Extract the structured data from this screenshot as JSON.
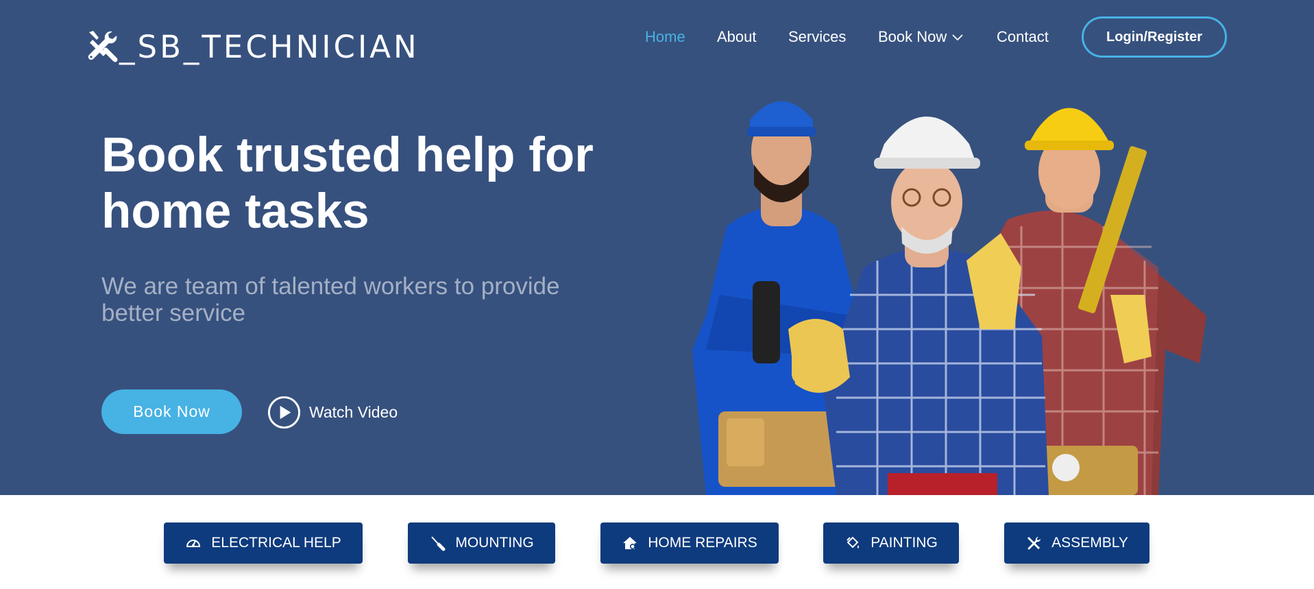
{
  "brand": {
    "name": "_SB_TECHNICIAN",
    "icon": "wrench-screwdriver-icon"
  },
  "nav": {
    "items": [
      {
        "label": "Home",
        "active": true
      },
      {
        "label": "About",
        "active": false
      },
      {
        "label": "Services",
        "active": false
      },
      {
        "label": "Book Now",
        "active": false,
        "dropdown": true
      },
      {
        "label": "Contact",
        "active": false
      }
    ],
    "login_label": "Login/Register"
  },
  "hero": {
    "title": "Book trusted help for home tasks",
    "subtitle": "We are team of talented workers to provide better service",
    "cta_label": "Book Now",
    "video_label": "Watch Video",
    "video_icon": "play-circle-icon",
    "image": "three construction workers with helmets and tools"
  },
  "services": [
    {
      "label": "ELECTRICAL HELP",
      "icon": "gauge-icon"
    },
    {
      "label": "MOUNTING",
      "icon": "screwdriver-icon"
    },
    {
      "label": "HOME REPAIRS",
      "icon": "house-gear-icon"
    },
    {
      "label": "PAINTING",
      "icon": "paint-bucket-icon"
    },
    {
      "label": "ASSEMBLY",
      "icon": "tools-icon"
    }
  ],
  "colors": {
    "hero_bg": "#37517e",
    "accent": "#47b2e4",
    "service_button": "#0e3b7e",
    "subtitle_text": "#a4b0c5"
  }
}
